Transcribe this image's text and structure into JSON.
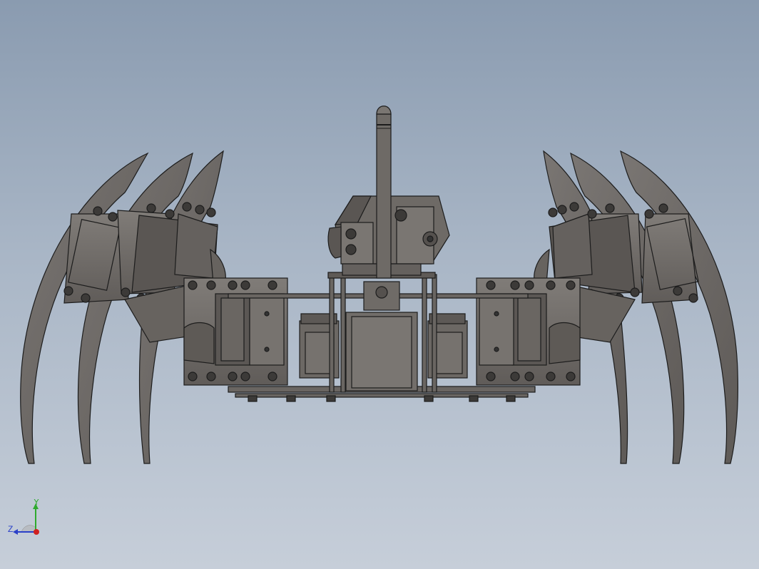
{
  "viewport": {
    "model": "hexapod-robot-assembly",
    "view": "front",
    "background_top": "#8a9bb0",
    "background_bottom": "#c6ced9",
    "part_color": "#6e6a66",
    "edge_color": "#1c1c1c"
  },
  "triad": {
    "y_label": "Y",
    "z_label": "Z",
    "y_color": "#2faa2f",
    "z_color": "#2a40c8",
    "x_color": "#d02020"
  }
}
